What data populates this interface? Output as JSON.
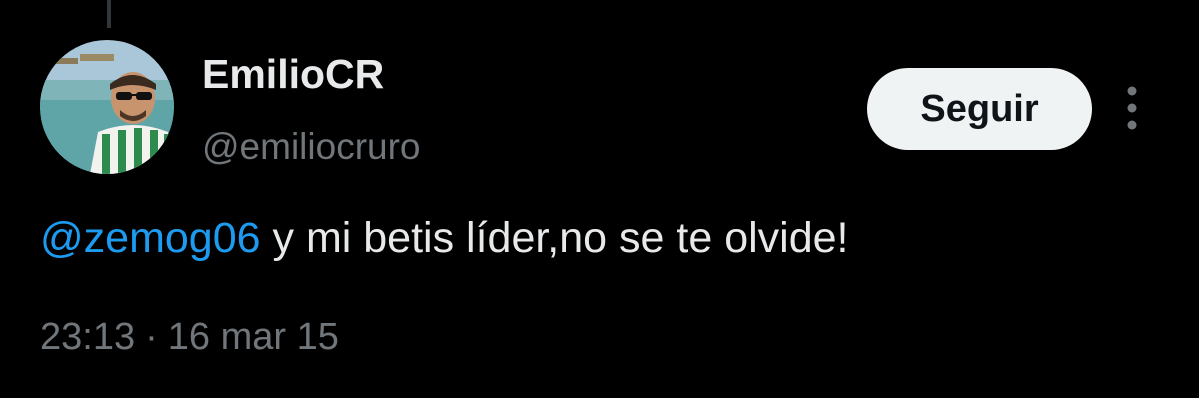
{
  "tweet": {
    "author": {
      "display_name": "EmilioCR",
      "handle": "@emiliocruro",
      "avatar_icon": "user-avatar-photo"
    },
    "follow_label": "Seguir",
    "more_icon": "more-vertical-icon",
    "text": {
      "mention": "@zemog06",
      "body": " y mi betis líder,no se te olvide!"
    },
    "time": "23:13",
    "separator": "·",
    "date": "16 mar 15"
  },
  "colors": {
    "background": "#000000",
    "primary_text": "#e7e9ea",
    "secondary_text": "#71767b",
    "link": "#1d9bf0",
    "button_bg": "#eff3f4",
    "button_text": "#0f1419"
  }
}
